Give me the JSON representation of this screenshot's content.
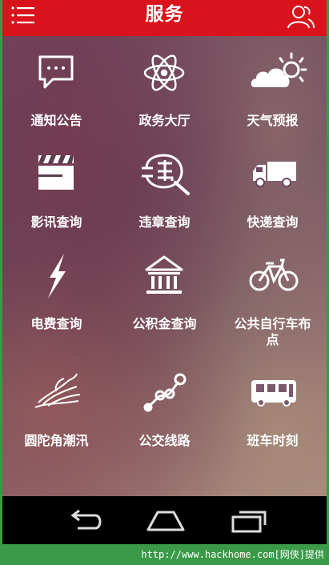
{
  "header": {
    "title": "服务"
  },
  "services": [
    {
      "label": "通知公告",
      "icon": "message-bubble-icon"
    },
    {
      "label": "政务大厅",
      "icon": "atom-icon"
    },
    {
      "label": "天气预报",
      "icon": "weather-icon"
    },
    {
      "label": "影讯查询",
      "icon": "clapperboard-icon"
    },
    {
      "label": "违章查询",
      "icon": "violation-search-icon"
    },
    {
      "label": "快递查询",
      "icon": "truck-icon"
    },
    {
      "label": "电费查询",
      "icon": "lightning-icon"
    },
    {
      "label": "公积金查询",
      "icon": "bank-icon"
    },
    {
      "label": "公共自行车布点",
      "icon": "bicycle-icon"
    },
    {
      "label": "圆陀角潮汛",
      "icon": "wave-icon"
    },
    {
      "label": "公交线路",
      "icon": "route-icon"
    },
    {
      "label": "班车时刻",
      "icon": "bus-icon"
    }
  ],
  "footer": {
    "text": "http://www.hackhome.com[网侠]提供"
  },
  "colors": {
    "header": "#d9131c",
    "footer": "#3a9a48",
    "navbar": "#000000"
  }
}
